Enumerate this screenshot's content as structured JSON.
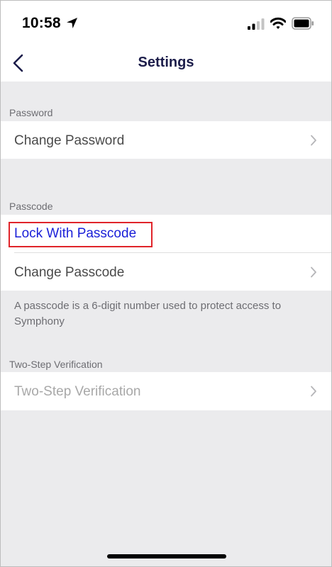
{
  "status": {
    "time": "10:58",
    "icons": [
      "location-arrow-icon",
      "cellular-signal-icon",
      "wifi-icon",
      "battery-icon"
    ]
  },
  "nav": {
    "title": "Settings",
    "back_icon": "chevron-left-icon"
  },
  "sections": {
    "password": {
      "header": "Password",
      "change_password": "Change Password"
    },
    "passcode": {
      "header": "Passcode",
      "lock_with_passcode": "Lock With Passcode",
      "change_passcode": "Change Passcode",
      "footer": "A passcode is a 6-digit number used to protect access to Symphony"
    },
    "two_step": {
      "header": "Two-Step Verification",
      "item": "Two-Step Verification"
    }
  },
  "colors": {
    "nav_title": "#1c1d4a",
    "link_blue": "#1a1fd8",
    "highlight_red": "#e0242a",
    "group_background": "#ebebed"
  }
}
